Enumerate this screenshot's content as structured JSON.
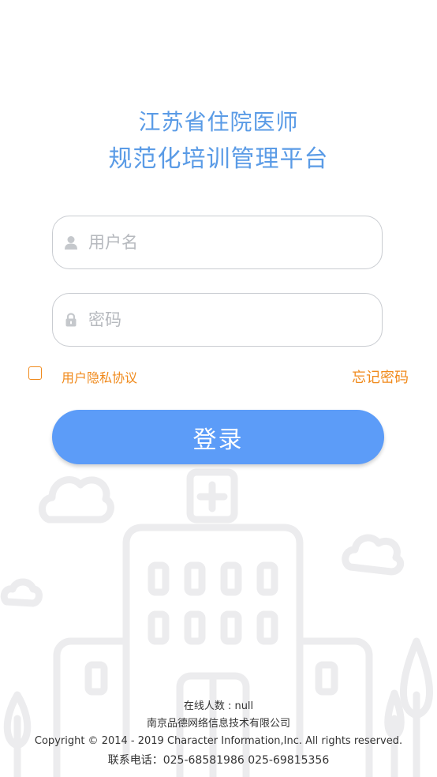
{
  "title": {
    "line1": "江苏省住院医师",
    "line2": "规范化培训管理平台"
  },
  "form": {
    "username_placeholder": "用户名",
    "password_placeholder": "密码",
    "user_icon": "user-icon",
    "lock_icon": "lock-icon"
  },
  "options": {
    "privacy_label": "用户隐私协议",
    "forgot_label": "忘记密码",
    "checkbox_checked": false
  },
  "login_button": "登录",
  "footer": {
    "online_count": "在线人数 : null",
    "company": "南京品德网络信息技术有限公司",
    "copyright": "Copyright © 2014 - 2019 Character Information,Inc. All rights reserved.",
    "phone": "联系电话：025-68581986 025-69815356"
  },
  "colors": {
    "title": "#5a9be6",
    "accent_orange": "#f08a1c",
    "button_blue": "#5c9cf8",
    "field_border": "#c9ccd1"
  }
}
